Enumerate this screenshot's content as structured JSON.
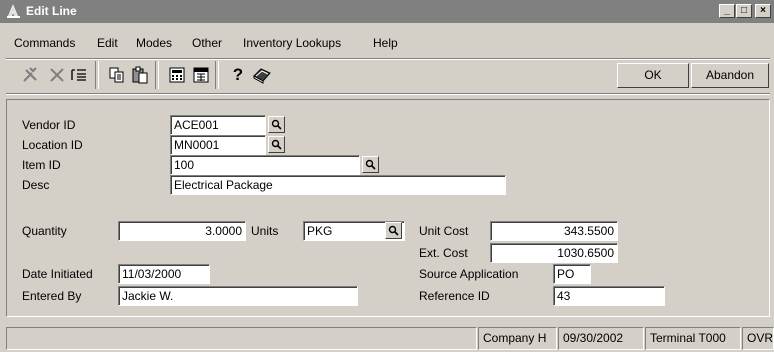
{
  "window": {
    "title": "Edit Line",
    "minimize": "_",
    "maximize": "□",
    "close": "×"
  },
  "menu": [
    "Commands",
    "Edit",
    "Modes",
    "Other",
    "Inventory Lookups",
    "Help"
  ],
  "toolbar": {
    "ok_label": "OK",
    "abandon_label": "Abandon",
    "help_glyph": "?"
  },
  "form": {
    "vendor_id": {
      "label": "Vendor ID",
      "value": "ACE001"
    },
    "location_id": {
      "label": "Location ID",
      "value": "MN0001"
    },
    "item_id": {
      "label": "Item ID",
      "value": "100"
    },
    "desc": {
      "label": "Desc",
      "value": "Electrical Package"
    },
    "quantity": {
      "label": "Quantity",
      "value": "3.0000"
    },
    "units": {
      "label": "Units",
      "value": "PKG"
    },
    "unit_cost": {
      "label": "Unit Cost",
      "value": "343.5500"
    },
    "ext_cost": {
      "label": "Ext. Cost",
      "value": "1030.6500"
    },
    "date_initiated": {
      "label": "Date Initiated",
      "value": "11/03/2000"
    },
    "source_application": {
      "label": "Source Application",
      "value": "PO"
    },
    "entered_by": {
      "label": "Entered By",
      "value": "Jackie W."
    },
    "reference_id": {
      "label": "Reference ID",
      "value": "43"
    }
  },
  "statusbar": {
    "message": "",
    "company": "Company H",
    "date": "09/30/2002",
    "terminal": "Terminal T000",
    "mode": "OVR"
  }
}
